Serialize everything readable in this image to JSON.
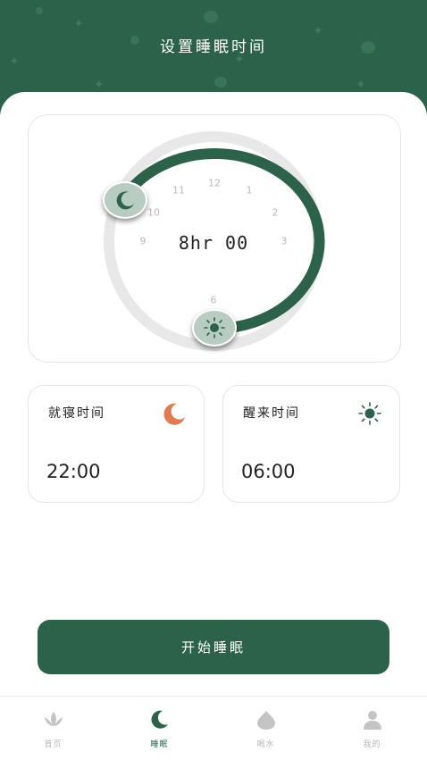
{
  "header": {
    "title": "设置睡眠时间"
  },
  "clock": {
    "numbers": [
      "12",
      "1",
      "2",
      "3",
      "6",
      "9",
      "10",
      "11"
    ],
    "duration": "8hr 00",
    "bed_hour": "22:00",
    "wake_hour": "06:00",
    "colors": {
      "arc": "#2b6249",
      "track": "#e8e8e8",
      "knob": "#b9ccc1"
    }
  },
  "bedtime": {
    "label": "就寝时间",
    "value": "22:00",
    "icon": "moon-icon",
    "icon_color": "#e07a4f"
  },
  "wake": {
    "label": "醒来时间",
    "value": "06:00",
    "icon": "sun-icon",
    "icon_color": "#2b6249"
  },
  "start_button": {
    "label": "开始睡眠"
  },
  "tabbar": {
    "items": [
      {
        "label": "首页",
        "icon": "lotus-icon",
        "active": false
      },
      {
        "label": "睡眠",
        "icon": "moon-icon",
        "active": true
      },
      {
        "label": "喝水",
        "icon": "water-drop-icon",
        "active": false
      },
      {
        "label": "我的",
        "icon": "user-icon",
        "active": false
      }
    ]
  },
  "colors": {
    "brand": "#2b6249",
    "accent": "#e07a4f"
  }
}
